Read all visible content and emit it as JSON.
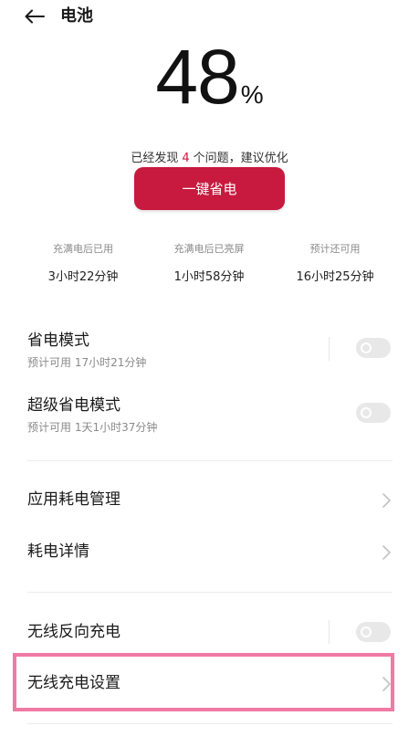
{
  "header": {
    "back_icon": "back-arrow-icon",
    "title": "电池"
  },
  "battery": {
    "percent": "48",
    "unit": "%"
  },
  "issues": {
    "prefix": "已经发现",
    "count": "4",
    "suffix": "个问题，建议优化",
    "accent_color": "#d0163f"
  },
  "optimize_button": {
    "label": "一键省电",
    "color": "#c8193f"
  },
  "stats": [
    {
      "label": "充满电后已用",
      "value": "3小时22分钟"
    },
    {
      "label": "充满电后已亮屏",
      "value": "1小时58分钟"
    },
    {
      "label": "预计还可用",
      "value": "16小时25分钟"
    }
  ],
  "power_saving_mode": {
    "title": "省电模式",
    "subtitle": "预计可用 17小时21分钟",
    "enabled": false
  },
  "super_power_saving_mode": {
    "title": "超级省电模式",
    "subtitle": "预计可用 1天1小时37分钟",
    "enabled": false
  },
  "app_power_management": {
    "title": "应用耗电管理",
    "icon": "chevron-right-icon"
  },
  "power_details": {
    "title": "耗电详情",
    "icon": "chevron-right-icon"
  },
  "wireless_reverse_charging": {
    "title": "无线反向充电",
    "enabled": false
  },
  "wireless_charging_settings": {
    "title": "无线充电设置",
    "icon": "chevron-right-icon",
    "highlight_color": "#f07aa3"
  }
}
